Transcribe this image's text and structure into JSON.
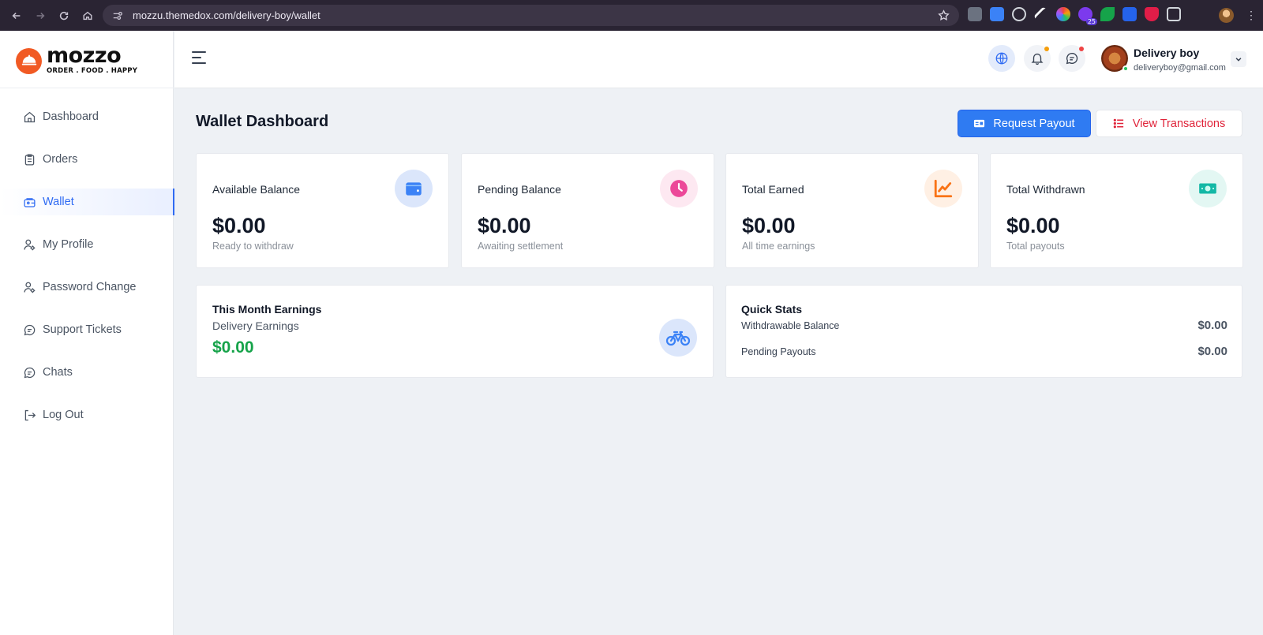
{
  "browser": {
    "url": "mozzu.themedox.com/delivery-boy/wallet",
    "extension_badge": "25"
  },
  "brand": {
    "name": "mozzo",
    "tagline": "ORDER . FOOD . HAPPY",
    "color": "#f15a24"
  },
  "sidebar": {
    "items": [
      {
        "label": "Dashboard",
        "icon": "home-icon"
      },
      {
        "label": "Orders",
        "icon": "clipboard-icon"
      },
      {
        "label": "Wallet",
        "icon": "wallet-icon",
        "active": true
      },
      {
        "label": "My Profile",
        "icon": "user-gear-icon"
      },
      {
        "label": "Password Change",
        "icon": "user-gear-icon"
      },
      {
        "label": "Support Tickets",
        "icon": "chat-bubble-icon"
      },
      {
        "label": "Chats",
        "icon": "chat-bubble-icon"
      },
      {
        "label": "Log Out",
        "icon": "logout-icon"
      }
    ]
  },
  "header": {
    "user_name": "Delivery boy",
    "user_email": "deliveryboy@gmail.com"
  },
  "page": {
    "title": "Wallet Dashboard",
    "request_payout_label": "Request Payout",
    "view_transactions_label": "View Transactions"
  },
  "stats": [
    {
      "label": "Available Balance",
      "amount": "$0.00",
      "sub": "Ready to withdraw",
      "icon": "wallet-icon",
      "color": "#3b82f6"
    },
    {
      "label": "Pending Balance",
      "amount": "$0.00",
      "sub": "Awaiting settlement",
      "icon": "clock-icon",
      "color": "#ec4899"
    },
    {
      "label": "Total Earned",
      "amount": "$0.00",
      "sub": "All time earnings",
      "icon": "chart-line-icon",
      "color": "#f97316"
    },
    {
      "label": "Total Withdrawn",
      "amount": "$0.00",
      "sub": "Total payouts",
      "icon": "money-icon",
      "color": "#14b8a6"
    }
  ],
  "month": {
    "title": "This Month Earnings",
    "subtitle": "Delivery Earnings",
    "value": "$0.00"
  },
  "quick_stats": {
    "title": "Quick Stats",
    "rows": [
      {
        "label": "Withdrawable Balance",
        "value": "$0.00"
      },
      {
        "label": "Pending Payouts",
        "value": "$0.00"
      }
    ]
  }
}
